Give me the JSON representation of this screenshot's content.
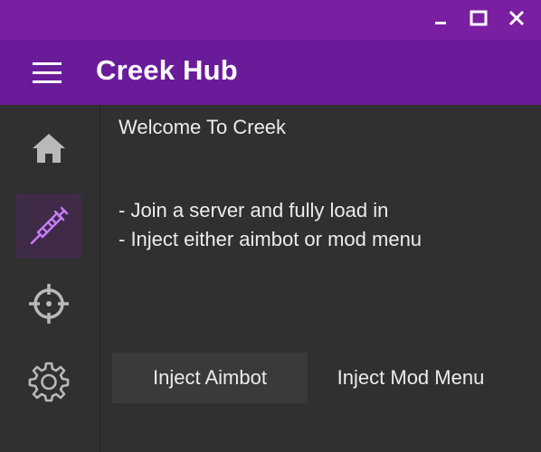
{
  "window": {
    "controls": {
      "minimize": "minimize-icon",
      "maximize": "maximize-icon",
      "close": "close-icon"
    }
  },
  "header": {
    "menu_icon": "hamburger-menu-icon",
    "title": "Creek Hub"
  },
  "sidebar": {
    "items": [
      {
        "id": "home",
        "icon": "home-icon",
        "active": false
      },
      {
        "id": "inject",
        "icon": "syringe-icon",
        "active": true
      },
      {
        "id": "aim",
        "icon": "crosshair-icon",
        "active": false
      },
      {
        "id": "settings",
        "icon": "gear-icon",
        "active": false
      }
    ]
  },
  "main": {
    "welcome": "Welcome To Creek",
    "instructions": [
      "- Join a server and fully load in",
      "- Inject either aimbot or mod menu"
    ],
    "buttons": {
      "inject_aimbot": "Inject Aimbot",
      "inject_mod_menu": "Inject Mod Menu"
    }
  },
  "colors": {
    "titlebar": "#7b1fa2",
    "appbar": "#6a1b9a",
    "background": "#303030",
    "accent_icon": "#c77dff",
    "icon": "#b9b9b9",
    "button_bg": "#3a3a3a"
  }
}
